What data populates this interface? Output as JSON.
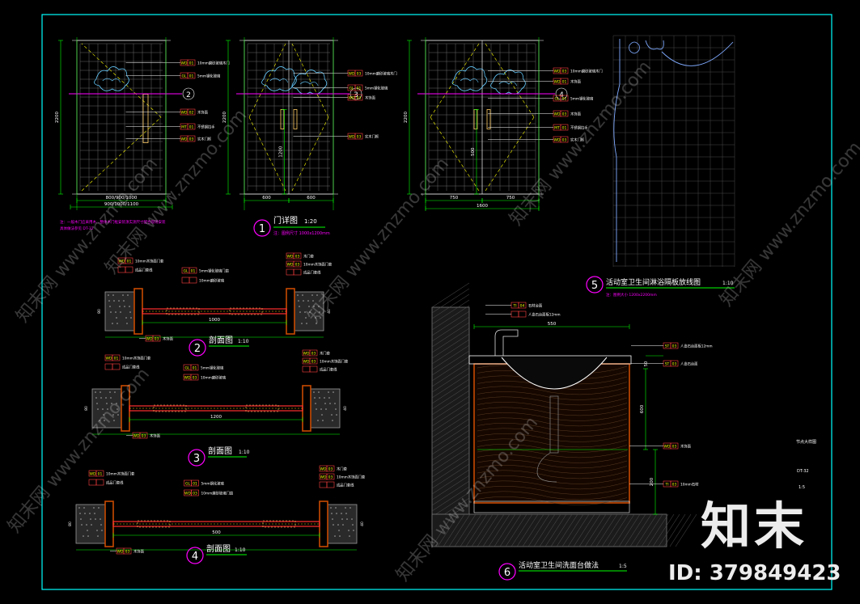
{
  "colors": {
    "background": "#000000",
    "border": "#00ffff",
    "dim": "#00ff00",
    "tag": "#ffff00",
    "tag_border": "#ff4040",
    "title_circle": "#ff00ff",
    "note": "#ff00ff",
    "section_cut": "#ff00ff",
    "wood": "#c84a00",
    "wall": "#808080",
    "tile": "#6a6a6a"
  },
  "watermark": {
    "logo": "知末",
    "id_text": "ID: 379849423",
    "repeat_text": "知末网 www.znzmo.com"
  },
  "views": {
    "elevation": {
      "num": "1",
      "title": "门详图",
      "scale": "1:20",
      "note": "注：图例尺寸 1000x1200mm"
    },
    "section2": {
      "num": "2",
      "title": "剖面图",
      "scale": "1:10"
    },
    "section3": {
      "num": "3",
      "title": "剖面图",
      "scale": "1:10"
    },
    "section4": {
      "num": "4",
      "title": "剖面图",
      "scale": "1:10"
    },
    "shower": {
      "num": "5",
      "title": "活动室卫生间淋浴隔板放线图",
      "scale": "1:10",
      "note": "注：图例大小 1200x2200mm"
    },
    "basin": {
      "num": "6",
      "title": "活动室卫生间洗面台做法",
      "scale": "1:5"
    }
  },
  "door_elevations": [
    {
      "cut": "2",
      "tags": [
        [
          "WD",
          "01",
          "10mm磨砂玻璃木门"
        ],
        [
          "GL",
          "01",
          "5mm钢化玻璃"
        ],
        [
          "WD",
          "02",
          "木饰面"
        ],
        [
          "MT",
          "01",
          "不锈钢拉手"
        ],
        [
          "WD",
          "03",
          "实木门框"
        ]
      ],
      "dims_v": [
        "2200"
      ],
      "dims_h": [
        "800/900/1000",
        "900/1000/1100"
      ]
    },
    {
      "cut": "3",
      "tags": [
        [
          "WD",
          "03",
          "10mm磨砂玻璃木门"
        ],
        [
          "GL",
          "01",
          "5mm钢化玻璃"
        ],
        [
          "WD",
          "03",
          "木饰面"
        ],
        [
          "WD",
          "03",
          "实木门框"
        ]
      ],
      "dims_v": [
        "2200",
        "1200"
      ],
      "dims_h": [
        "600",
        "600"
      ]
    },
    {
      "cut": "4",
      "tags": [
        [
          "WD",
          "03",
          "10mm磨砂玻璃木门"
        ],
        [
          "WD",
          "01",
          "木饰面"
        ],
        [
          "GL",
          "01",
          "5mm钢化玻璃"
        ],
        [
          "WD",
          "03",
          "木饰面"
        ],
        [
          "MT",
          "01",
          "不锈钢拉手"
        ],
        [
          "WD",
          "03",
          "实木门框"
        ]
      ],
      "dims_v": [
        "2200",
        "500"
      ],
      "dims_h": [
        "750",
        "750",
        "1600"
      ]
    }
  ],
  "sections": [
    {
      "tags_l": [
        [
          "WD",
          "01",
          "10mm木饰面门套"
        ],
        [
          "",
          "",
          "成品门套线"
        ]
      ],
      "tags_r": [
        [
          "WD",
          "03",
          "木门套"
        ],
        [
          "WD",
          "03",
          "10mm木饰面门套"
        ],
        [
          "",
          "",
          "成品门套线"
        ]
      ],
      "tags_m": [
        [
          "GL",
          "01",
          "5mm钢化玻璃门扇"
        ],
        [
          "",
          "",
          "10mm磨砂玻璃"
        ]
      ],
      "tag_b": [
        "WD",
        "03",
        "木饰面"
      ],
      "dim": "1000"
    },
    {
      "tags_l": [
        [
          "WD",
          "01",
          "10mm木饰面门套"
        ],
        [
          "",
          "",
          "成品门套线"
        ]
      ],
      "tags_r": [
        [
          "WD",
          "03",
          "木门套"
        ],
        [
          "WD",
          "03",
          "10mm木饰面门套"
        ],
        [
          "",
          "",
          "成品门套线"
        ]
      ],
      "tags_m": [
        [
          "GL",
          "01",
          "5mm钢化玻璃"
        ],
        [
          "WD",
          "03",
          "10mm磨砂玻璃"
        ]
      ],
      "tag_b": [
        "WD",
        "03",
        "木饰面"
      ],
      "dim": "1200"
    },
    {
      "tags_l": [
        [
          "WD",
          "01",
          "10mm木饰面门套"
        ],
        [
          "",
          "",
          "成品门套线"
        ]
      ],
      "tags_r": [
        [
          "WD",
          "03",
          "木门套"
        ],
        [
          "WD",
          "03",
          "10mm木饰面门套"
        ],
        [
          "",
          "",
          "成品门套线"
        ]
      ],
      "tags_m": [
        [
          "GL",
          "01",
          "5mm钢化玻璃"
        ],
        [
          "WD",
          "03",
          "10mm磨砂玻璃门扇"
        ]
      ],
      "tag_b": [
        "WD",
        "03",
        "木饰面"
      ],
      "dim": "500"
    }
  ],
  "basin_tags": {
    "top": [
      [
        "TI",
        "04",
        "石材台面"
      ],
      [
        "",
        "",
        "人造石台面板12mm"
      ]
    ],
    "right": [
      [
        "ST",
        "03",
        "人造石台面板12mm"
      ],
      [
        "ST",
        "03",
        "人造石台面"
      ]
    ],
    "mid": [
      "WD",
      "03",
      "木饰面"
    ],
    "bottom": [
      "TI",
      "03",
      "10mm石材"
    ],
    "dims": [
      "550",
      "50",
      "200",
      "600"
    ],
    "side_note": "节点大样图",
    "code": "DT-32",
    "scale_small": "1:5"
  }
}
